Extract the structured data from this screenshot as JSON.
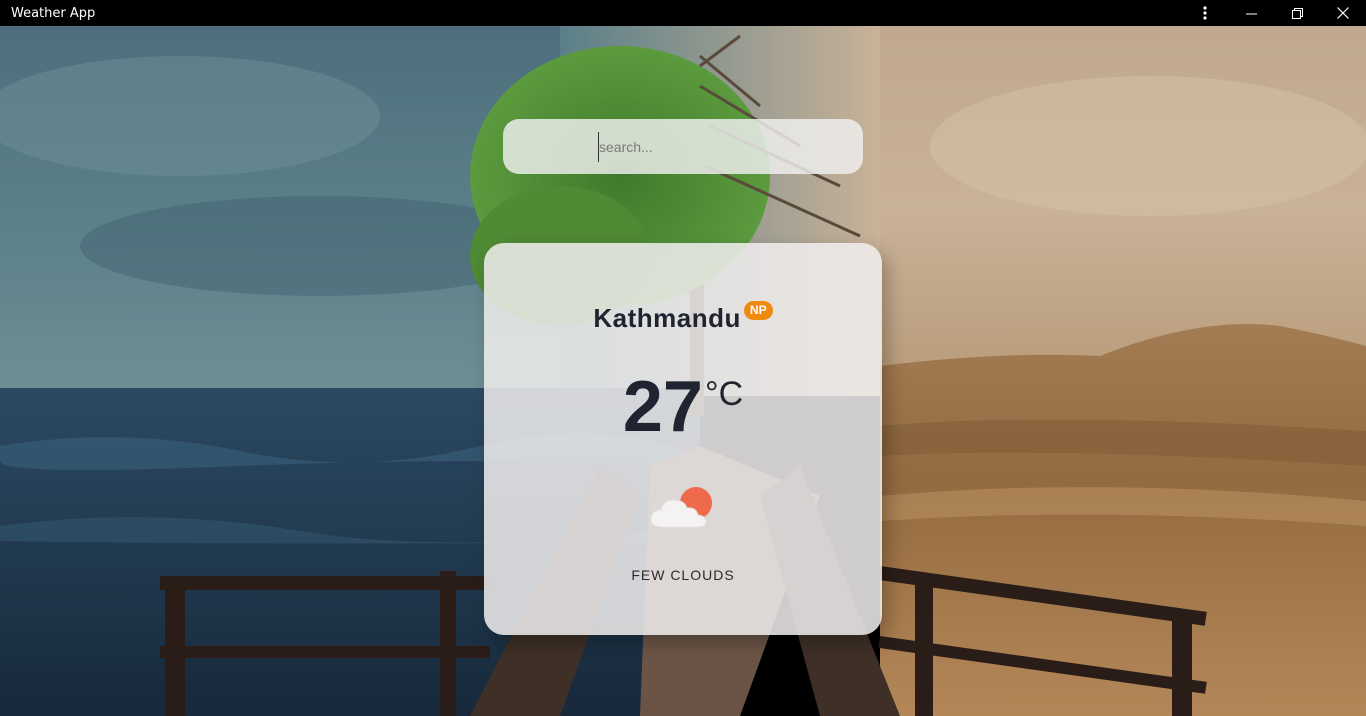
{
  "window": {
    "title": "Weather App",
    "controls": [
      "more-icon",
      "minimize-icon",
      "restore-icon",
      "close-icon"
    ]
  },
  "search": {
    "placeholder": "search...",
    "value": ""
  },
  "weather": {
    "city": "Kathmandu",
    "country_code": "NP",
    "temperature": "27",
    "unit": "°C",
    "condition": "FEW CLOUDS",
    "icon": "few-clouds-icon"
  },
  "colors": {
    "badge": "#ef8a10",
    "sun": "#ee6a4a",
    "text": "#1f2430"
  }
}
